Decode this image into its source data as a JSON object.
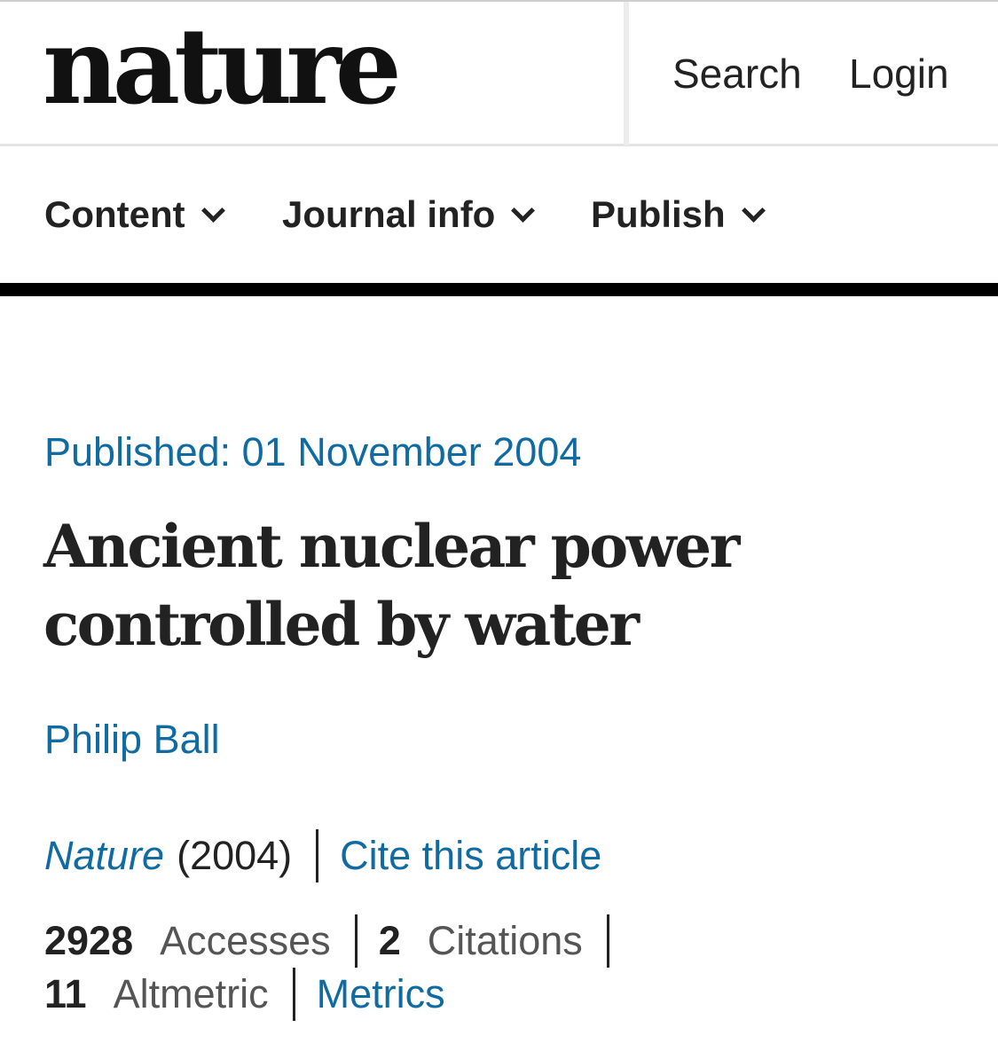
{
  "header": {
    "logo": "nature",
    "search_label": "Search",
    "login_label": "Login"
  },
  "nav": {
    "items": [
      {
        "label": "Content"
      },
      {
        "label": "Journal info"
      },
      {
        "label": "Publish"
      }
    ]
  },
  "article": {
    "published": "Published: 01 November 2004",
    "title_line1": "Ancient nuclear power",
    "title_line2": "controlled by water",
    "author": "Philip Ball",
    "journal": "Nature",
    "year": "(2004)",
    "cite_label": "Cite this article"
  },
  "metrics": {
    "accesses_count": "2928",
    "accesses_label": "Accesses",
    "citations_count": "2",
    "citations_label": "Citations",
    "altmetric_count": "11",
    "altmetric_label": "Altmetric",
    "metrics_link": "Metrics"
  },
  "colors": {
    "link": "#0f6ba1",
    "text": "#222222",
    "rule": "#000000"
  }
}
